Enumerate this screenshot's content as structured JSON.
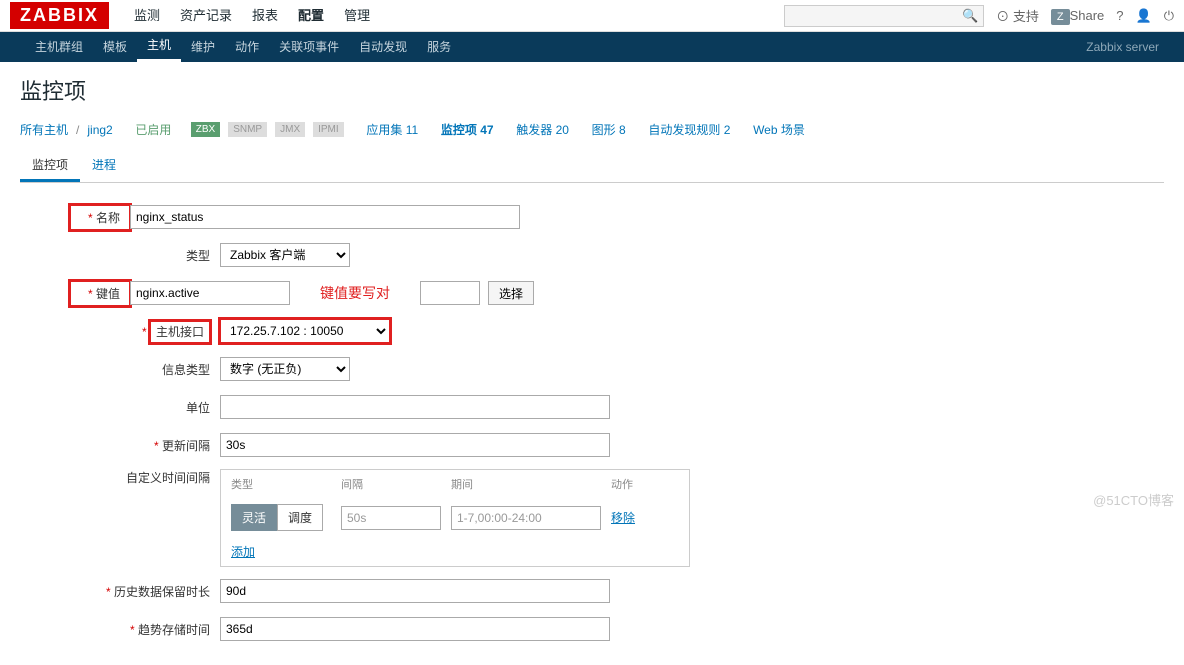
{
  "logo": "ZABBIX",
  "topnav": [
    "监测",
    "资产记录",
    "报表",
    "配置",
    "管理"
  ],
  "topnav_active": 3,
  "topright": {
    "support": "支持",
    "share": "Share"
  },
  "subnav": [
    "主机群组",
    "模板",
    "主机",
    "维护",
    "动作",
    "关联项事件",
    "自动发现",
    "服务"
  ],
  "subnav_active": 2,
  "server_label": "Zabbix server",
  "page_title": "监控项",
  "breadcrumb": {
    "all_hosts": "所有主机",
    "host": "jing2",
    "enabled": "已启用",
    "badges": [
      "ZBX",
      "SNMP",
      "JMX",
      "IPMI"
    ],
    "links": [
      {
        "label": "应用集",
        "count": 11
      },
      {
        "label": "监控项",
        "count": 47,
        "active": true
      },
      {
        "label": "触发器",
        "count": 20
      },
      {
        "label": "图形",
        "count": 8
      },
      {
        "label": "自动发现规则",
        "count": 2
      },
      {
        "label": "Web 场景",
        "count": ""
      }
    ]
  },
  "tabs": [
    "监控项",
    "进程"
  ],
  "form": {
    "name_label": "名称",
    "name_value": "nginx_status",
    "type_label": "类型",
    "type_value": "Zabbix 客户端",
    "key_label": "键值",
    "key_value": "nginx.active",
    "key_select_btn": "选择",
    "key_note": "键值要写对",
    "interface_label": "主机接口",
    "interface_value": "172.25.7.102 : 10050",
    "info_type_label": "信息类型",
    "info_type_value": "数字 (无正负)",
    "units_label": "单位",
    "units_value": "",
    "update_interval_label": "更新间隔",
    "update_interval_value": "30s",
    "custom_interval_label": "自定义时间间隔",
    "interval_headers": [
      "类型",
      "间隔",
      "期间",
      "动作"
    ],
    "toggle_options": [
      "灵活",
      "调度"
    ],
    "interval_default": "50s",
    "period_default": "1-7,00:00-24:00",
    "remove_link": "移除",
    "add_link": "添加",
    "history_label": "历史数据保留时长",
    "history_value": "90d",
    "trend_label": "趋势存储时间",
    "trend_value": "365d"
  },
  "watermark": "@51CTO博客"
}
